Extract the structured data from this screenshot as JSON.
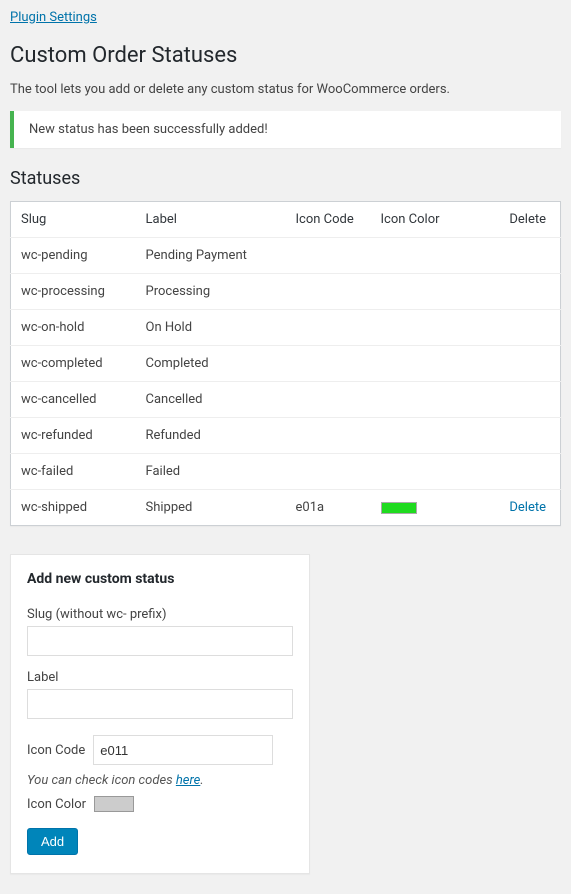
{
  "links": {
    "plugin_settings": "Plugin Settings"
  },
  "page_title": "Custom Order Statuses",
  "description": "The tool lets you add or delete any custom status for WooCommerce orders.",
  "notice": "New status has been successfully added!",
  "statuses_heading": "Statuses",
  "table": {
    "headers": {
      "slug": "Slug",
      "label": "Label",
      "icon_code": "Icon Code",
      "icon_color": "Icon Color",
      "delete": "Delete"
    },
    "rows": [
      {
        "slug": "wc-pending",
        "label": "Pending Payment",
        "icon_code": "",
        "icon_color": "",
        "delete": ""
      },
      {
        "slug": "wc-processing",
        "label": "Processing",
        "icon_code": "",
        "icon_color": "",
        "delete": ""
      },
      {
        "slug": "wc-on-hold",
        "label": "On Hold",
        "icon_code": "",
        "icon_color": "",
        "delete": ""
      },
      {
        "slug": "wc-completed",
        "label": "Completed",
        "icon_code": "",
        "icon_color": "",
        "delete": ""
      },
      {
        "slug": "wc-cancelled",
        "label": "Cancelled",
        "icon_code": "",
        "icon_color": "",
        "delete": ""
      },
      {
        "slug": "wc-refunded",
        "label": "Refunded",
        "icon_code": "",
        "icon_color": "",
        "delete": ""
      },
      {
        "slug": "wc-failed",
        "label": "Failed",
        "icon_code": "",
        "icon_color": "",
        "delete": ""
      },
      {
        "slug": "wc-shipped",
        "label": "Shipped",
        "icon_code": "e01a",
        "icon_color": "#1fdb1f",
        "delete": "Delete"
      }
    ]
  },
  "form": {
    "heading": "Add new custom status",
    "slug_label": "Slug (without wc- prefix)",
    "slug_value": "",
    "label_label": "Label",
    "label_value": "",
    "icon_code_label": "Icon Code",
    "icon_code_value": "e011",
    "hint_prefix": "You can check icon codes ",
    "hint_link": "here",
    "hint_suffix": ".",
    "icon_color_label": "Icon Color",
    "icon_color_value": "#cccccc",
    "submit": "Add"
  }
}
